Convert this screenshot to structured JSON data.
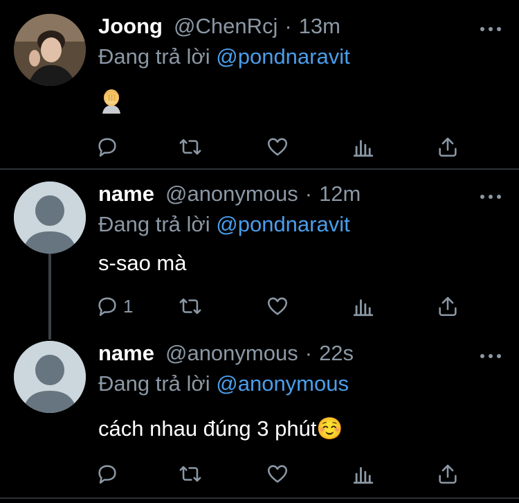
{
  "tweets": [
    {
      "display_name": "Joong",
      "handle": "@ChenRcj",
      "time": "13m",
      "reply_prefix": "Đang trả lời",
      "reply_to": "@pondnaravit",
      "text": "",
      "reply_count": ""
    },
    {
      "display_name": "name",
      "handle": "@anonymous",
      "time": "12m",
      "reply_prefix": "Đang trả lời",
      "reply_to": "@pondnaravit",
      "text": "s-sao mà",
      "reply_count": "1"
    },
    {
      "display_name": "name",
      "handle": "@anonymous",
      "time": "22s",
      "reply_prefix": "Đang trả lời",
      "reply_to": "@anonymous",
      "text": "cách nhau đúng 3 phút☺️",
      "reply_count": ""
    }
  ],
  "separator": "·",
  "icons": {
    "reply": "reply-icon",
    "retweet": "retweet-icon",
    "like": "heart-icon",
    "analytics": "analytics-icon",
    "share": "share-icon",
    "more": "more-icon",
    "emoji": "face-palm-emoji"
  },
  "colors": {
    "background": "#000000",
    "text": "#ffffff",
    "secondary": "#8b98a5",
    "mention": "#4a9eeb",
    "divider": "#2f3336"
  }
}
